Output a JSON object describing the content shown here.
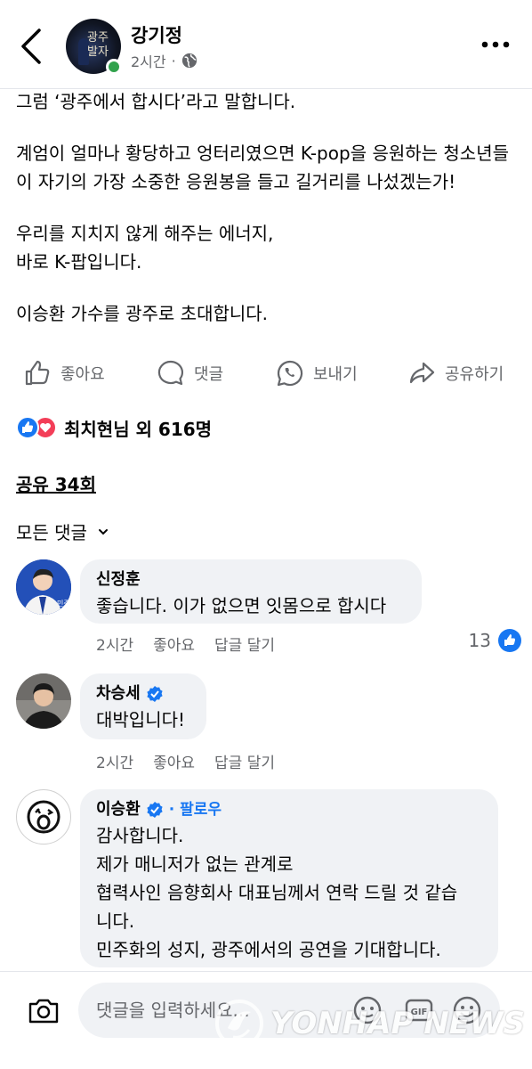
{
  "post": {
    "author": "강기정",
    "time": "2시간",
    "separator": "·",
    "body": [
      "그럼 ‘광주에서 합시다’라고 말합니다.",
      "계엄이 얼마나 황당하고 엉터리였으면 K-pop을 응원하는 청소년들이 자기의 가장 소중한 응원봉을 들고 길거리를 나섰겠는가!",
      "우리를 지치지 않게 해주는 에너지,\n바로 K-팝입니다.",
      "이승환 가수를 광주로 초대합니다."
    ]
  },
  "actions": {
    "like": "좋아요",
    "comment": "댓글",
    "send": "보내기",
    "share": "공유하기"
  },
  "reactions": {
    "text": "최치현님 외 616명"
  },
  "shares": "공유 34회",
  "filter": "모든 댓글",
  "comments": [
    {
      "name": "신정훈",
      "text": "좋습니다. 이가 없으면 잇몸으로 합시다",
      "time": "2시간",
      "like": "좋아요",
      "reply": "답글 달기",
      "likes": "13"
    },
    {
      "name": "차승세",
      "text": "대박입니다!",
      "time": "2시간",
      "like": "좋아요",
      "reply": "답글 달기"
    },
    {
      "name": "이승환",
      "follow": "· 팔로우",
      "lines": [
        "감사합니다.",
        "제가 매니저가 없는 관계로",
        "협력사인 음향회사 대표님께서 연락 드릴 것 같습",
        "니다.",
        "민주화의 성지, 광주에서의 공연을 기대합니다."
      ]
    }
  ],
  "composer": {
    "placeholder": "댓글을 입력하세요..."
  },
  "colors": {
    "accent": "#1877f2",
    "love": "#f33e58",
    "online": "#31a24c",
    "secondary_text": "#65676b",
    "bubble": "#f0f2f5"
  },
  "watermark": "YONHAP NEWS"
}
